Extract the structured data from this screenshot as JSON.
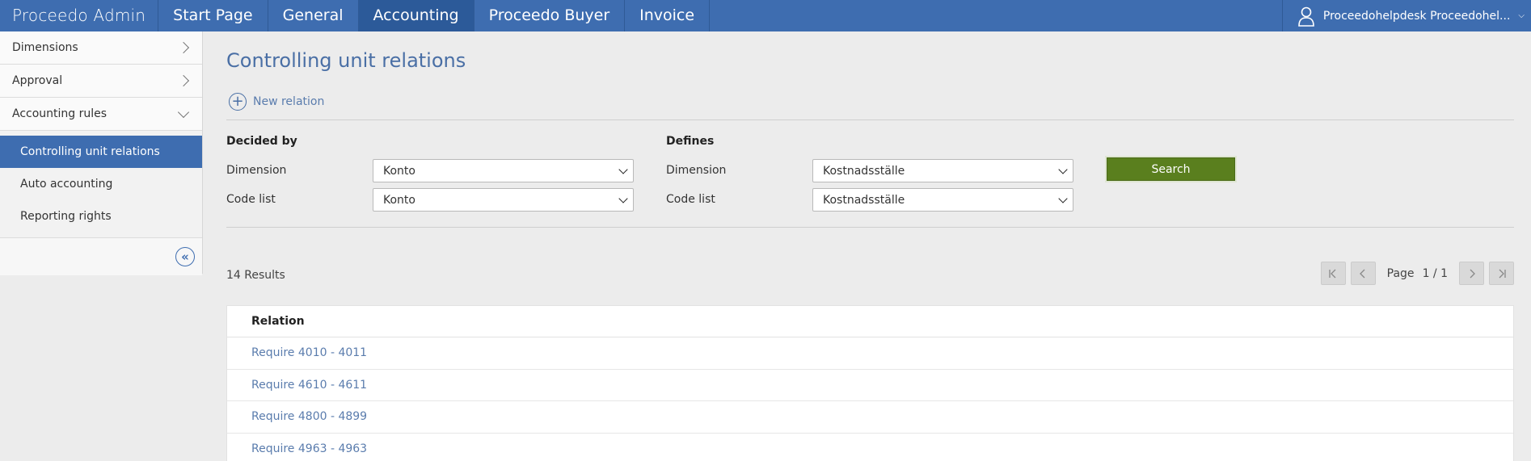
{
  "topnav": {
    "brand": "Proceedo Admin",
    "items": [
      {
        "label": "Start Page"
      },
      {
        "label": "General"
      },
      {
        "label": "Accounting"
      },
      {
        "label": "Proceedo Buyer"
      },
      {
        "label": "Invoice"
      }
    ],
    "active_item": "Accounting",
    "user_label": "Proceedohelpdesk Proceedohel..."
  },
  "sidebar": {
    "sections": [
      {
        "label": "Dimensions",
        "icon": "chevron-right-icon"
      },
      {
        "label": "Approval",
        "icon": "chevron-right-icon"
      },
      {
        "label": "Accounting rules",
        "icon": "chevron-down-icon"
      }
    ],
    "subitems": [
      {
        "label": "Controlling unit relations",
        "active": true
      },
      {
        "label": "Auto accounting",
        "active": false
      },
      {
        "label": "Reporting rights",
        "active": false
      }
    ],
    "collapse_icon": "double-chevron-left-icon"
  },
  "main": {
    "title": "Controlling unit relations",
    "new_relation_label": "New relation",
    "decided_by": {
      "heading": "Decided by",
      "dimension_label": "Dimension",
      "dimension_value": "Konto",
      "codelist_label": "Code list",
      "codelist_value": "Konto"
    },
    "defines": {
      "heading": "Defines",
      "dimension_label": "Dimension",
      "dimension_value": "Kostnadsställe",
      "codelist_label": "Code list",
      "codelist_value": "Kostnadsställe"
    },
    "search_label": "Search",
    "results_label": "14 Results",
    "pager": {
      "page_label": "Page",
      "page_value": "1 / 1"
    },
    "table": {
      "header": "Relation",
      "rows": [
        "Require 4010 - 4011",
        "Require 4610 - 4611",
        "Require 4800 - 4899",
        "Require 4963 - 4963"
      ]
    }
  },
  "colors": {
    "topbar": "#3e6db0",
    "accent_text": "#4a6fa5",
    "search_button": "#5a7f1e",
    "background": "#ececec"
  }
}
